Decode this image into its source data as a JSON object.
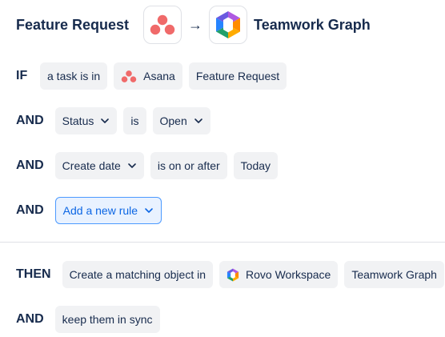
{
  "header": {
    "source_label": "Feature Request",
    "source_app_icon": "asana-icon",
    "arrow": "→",
    "target_app_icon": "rovo-graph-icon",
    "target_label": "Teamwork Graph"
  },
  "rules": {
    "if_row": {
      "keyword": "IF",
      "condition": "a task is in",
      "app": "Asana",
      "value": "Feature Request"
    },
    "status_row": {
      "keyword": "AND",
      "field": "Status",
      "operator": "is",
      "value": "Open"
    },
    "date_row": {
      "keyword": "AND",
      "field": "Create date",
      "operator": "is on or after",
      "value": "Today"
    },
    "add_row": {
      "keyword": "AND",
      "button": "Add a new rule"
    }
  },
  "actions": {
    "then_row": {
      "keyword": "THEN",
      "action": "Create a matching object in",
      "workspace": "Rovo Workspace",
      "target": "Teamwork Graph"
    },
    "sync_row": {
      "keyword": "AND",
      "action": "keep them in sync"
    }
  },
  "colors": {
    "asana": "#F06A6A",
    "accent_blue": "#0C66E4",
    "chip_bg": "#F1F2F4"
  }
}
